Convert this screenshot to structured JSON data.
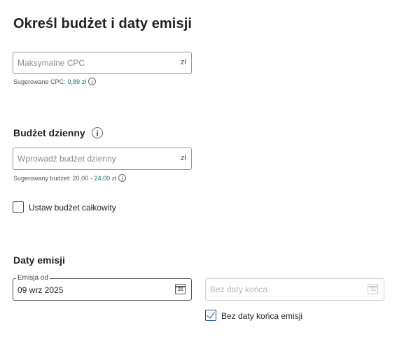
{
  "page_title": "Określ budżet i daty emisji",
  "cpc": {
    "placeholder": "Maksymalne CPC",
    "unit": "zł",
    "hint_prefix": "Sugerowane CPC:",
    "hint_value": "0,89 zł"
  },
  "daily_budget": {
    "section_title": "Budżet dzienny",
    "placeholder": "Wprowadź budżet dzienny",
    "unit": "zł",
    "hint_prefix": "Sugerowany budżet: 20,00",
    "hint_value": "- 24,00 zł"
  },
  "total_budget": {
    "label": "Ustaw budżet całkowity",
    "checked": false
  },
  "emission_dates": {
    "section_title": "Daty emisji",
    "start": {
      "label": "Emisja od",
      "value": "09 wrz 2025",
      "calendar_icon_text": "31"
    },
    "end": {
      "placeholder": "Bez daty końca",
      "calendar_icon_text": "31"
    },
    "no_end_date": {
      "label": "Bez daty końca emisji",
      "checked": true
    }
  },
  "colors": {
    "accent": "#0e6e79",
    "checkbox_checked": "#1e4f97"
  }
}
